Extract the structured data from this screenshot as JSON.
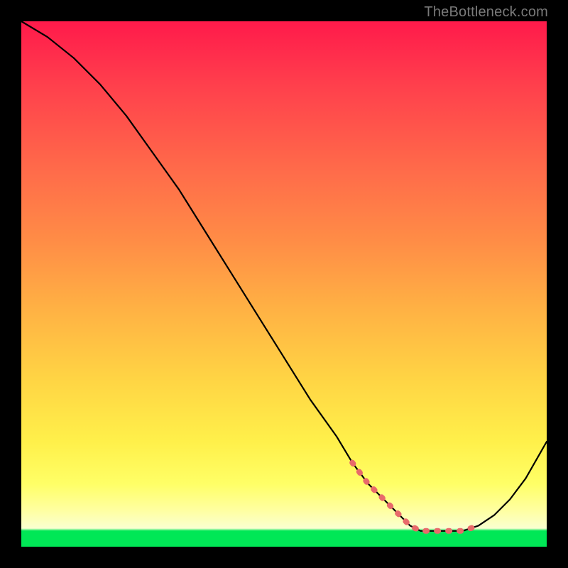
{
  "watermark": "TheBottleneck.com",
  "chart_data": {
    "type": "line",
    "title": "",
    "xlabel": "",
    "ylabel": "",
    "xlim": [
      0,
      100
    ],
    "ylim": [
      0,
      100
    ],
    "grid": false,
    "legend": false,
    "annotations": [],
    "series": [
      {
        "name": "curve",
        "x": [
          0,
          5,
          10,
          15,
          20,
          25,
          30,
          35,
          40,
          45,
          50,
          55,
          60,
          63,
          66,
          69,
          72,
          74,
          76,
          78,
          80,
          82,
          84,
          87,
          90,
          93,
          96,
          100
        ],
        "y": [
          100,
          97,
          93,
          88,
          82,
          75,
          68,
          60,
          52,
          44,
          36,
          28,
          21,
          16,
          12,
          9,
          6,
          4,
          3,
          3,
          3,
          3,
          3,
          4,
          6,
          9,
          13,
          20
        ],
        "highlight_x": [
          63,
          66,
          69,
          72,
          74,
          76,
          78,
          80,
          82,
          84,
          87
        ],
        "highlight_y": [
          16,
          12,
          9,
          6,
          4,
          3,
          3,
          3,
          3,
          3,
          4
        ]
      }
    ],
    "colors": {
      "curve": "#000000",
      "highlight": "#e86a6a",
      "gradient_top": "#ff1a4b",
      "gradient_bottom": "#00e756"
    }
  }
}
